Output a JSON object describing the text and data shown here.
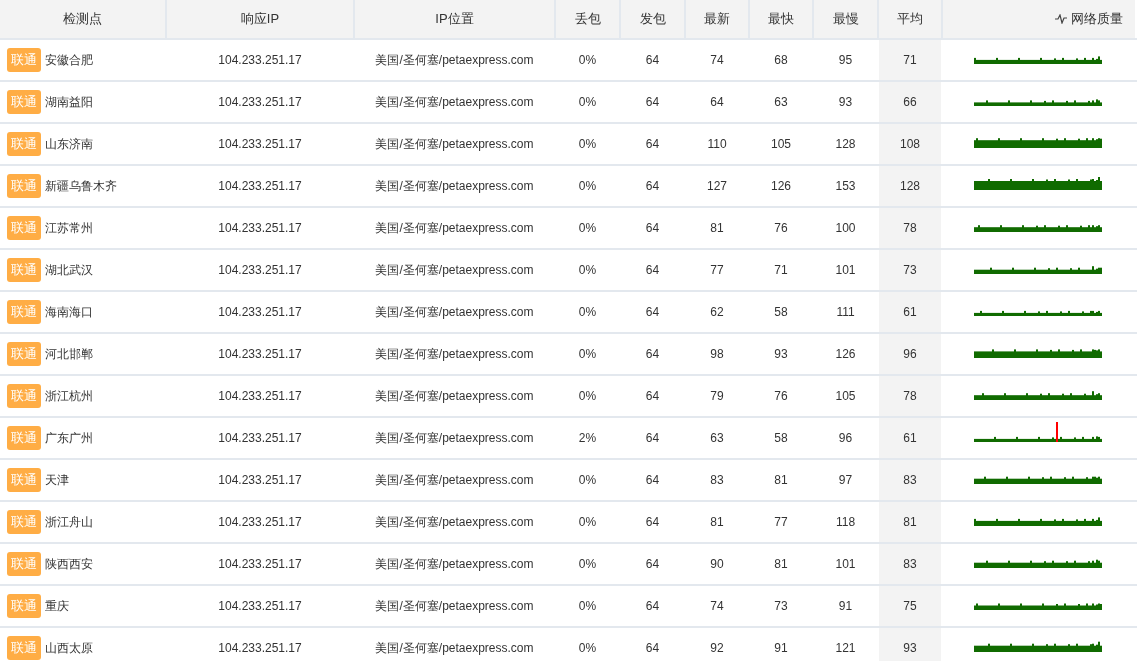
{
  "table": {
    "columns": [
      "检测点",
      "响应IP",
      "IP位置",
      "丢包",
      "发包",
      "最新",
      "最快",
      "最慢",
      "平均",
      "网络质量"
    ],
    "rows": [
      {
        "isp": "联通",
        "node": "安徽合肥",
        "ip": "104.233.251.17",
        "location": "美国/圣何塞/petaexpress.com",
        "loss": "0%",
        "sent": "64",
        "latest": "74",
        "fastest": "68",
        "slowest": "95",
        "avg": "71",
        "loss_spike": false
      },
      {
        "isp": "联通",
        "node": "湖南益阳",
        "ip": "104.233.251.17",
        "location": "美国/圣何塞/petaexpress.com",
        "loss": "0%",
        "sent": "64",
        "latest": "64",
        "fastest": "63",
        "slowest": "93",
        "avg": "66",
        "loss_spike": false
      },
      {
        "isp": "联通",
        "node": "山东济南",
        "ip": "104.233.251.17",
        "location": "美国/圣何塞/petaexpress.com",
        "loss": "0%",
        "sent": "64",
        "latest": "110",
        "fastest": "105",
        "slowest": "128",
        "avg": "108",
        "loss_spike": false
      },
      {
        "isp": "联通",
        "node": "新疆乌鲁木齐",
        "ip": "104.233.251.17",
        "location": "美国/圣何塞/petaexpress.com",
        "loss": "0%",
        "sent": "64",
        "latest": "127",
        "fastest": "126",
        "slowest": "153",
        "avg": "128",
        "loss_spike": false
      },
      {
        "isp": "联通",
        "node": "江苏常州",
        "ip": "104.233.251.17",
        "location": "美国/圣何塞/petaexpress.com",
        "loss": "0%",
        "sent": "64",
        "latest": "81",
        "fastest": "76",
        "slowest": "100",
        "avg": "78",
        "loss_spike": false
      },
      {
        "isp": "联通",
        "node": "湖北武汉",
        "ip": "104.233.251.17",
        "location": "美国/圣何塞/petaexpress.com",
        "loss": "0%",
        "sent": "64",
        "latest": "77",
        "fastest": "71",
        "slowest": "101",
        "avg": "73",
        "loss_spike": false
      },
      {
        "isp": "联通",
        "node": "海南海口",
        "ip": "104.233.251.17",
        "location": "美国/圣何塞/petaexpress.com",
        "loss": "0%",
        "sent": "64",
        "latest": "62",
        "fastest": "58",
        "slowest": "111",
        "avg": "61",
        "loss_spike": false
      },
      {
        "isp": "联通",
        "node": "河北邯郸",
        "ip": "104.233.251.17",
        "location": "美国/圣何塞/petaexpress.com",
        "loss": "0%",
        "sent": "64",
        "latest": "98",
        "fastest": "93",
        "slowest": "126",
        "avg": "96",
        "loss_spike": false
      },
      {
        "isp": "联通",
        "node": "浙江杭州",
        "ip": "104.233.251.17",
        "location": "美国/圣何塞/petaexpress.com",
        "loss": "0%",
        "sent": "64",
        "latest": "79",
        "fastest": "76",
        "slowest": "105",
        "avg": "78",
        "loss_spike": false
      },
      {
        "isp": "联通",
        "node": "广东广州",
        "ip": "104.233.251.17",
        "location": "美国/圣何塞/petaexpress.com",
        "loss": "2%",
        "sent": "64",
        "latest": "63",
        "fastest": "58",
        "slowest": "96",
        "avg": "61",
        "loss_spike": true
      },
      {
        "isp": "联通",
        "node": "天津",
        "ip": "104.233.251.17",
        "location": "美国/圣何塞/petaexpress.com",
        "loss": "0%",
        "sent": "64",
        "latest": "83",
        "fastest": "81",
        "slowest": "97",
        "avg": "83",
        "loss_spike": false
      },
      {
        "isp": "联通",
        "node": "浙江舟山",
        "ip": "104.233.251.17",
        "location": "美国/圣何塞/petaexpress.com",
        "loss": "0%",
        "sent": "64",
        "latest": "81",
        "fastest": "77",
        "slowest": "118",
        "avg": "81",
        "loss_spike": false
      },
      {
        "isp": "联通",
        "node": "陕西西安",
        "ip": "104.233.251.17",
        "location": "美国/圣何塞/petaexpress.com",
        "loss": "0%",
        "sent": "64",
        "latest": "90",
        "fastest": "81",
        "slowest": "101",
        "avg": "83",
        "loss_spike": false
      },
      {
        "isp": "联通",
        "node": "重庆",
        "ip": "104.233.251.17",
        "location": "美国/圣何塞/petaexpress.com",
        "loss": "0%",
        "sent": "64",
        "latest": "74",
        "fastest": "73",
        "slowest": "91",
        "avg": "75",
        "loss_spike": false
      },
      {
        "isp": "联通",
        "node": "山西太原",
        "ip": "104.233.251.17",
        "location": "美国/圣何塞/petaexpress.com",
        "loss": "0%",
        "sent": "64",
        "latest": "92",
        "fastest": "91",
        "slowest": "121",
        "avg": "93",
        "loss_spike": false
      }
    ]
  }
}
